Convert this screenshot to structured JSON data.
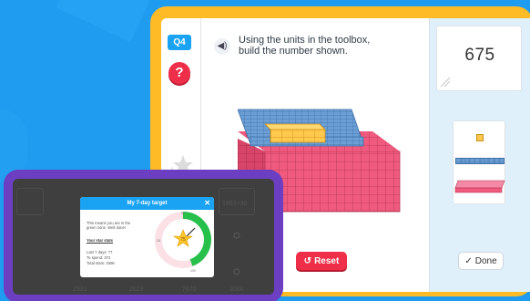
{
  "question": {
    "badge": "Q4",
    "help_glyph": "?",
    "sound_glyph": "◀)",
    "instruction_line1": "Using the units in the toolbox,",
    "instruction_line2": "build the number shown."
  },
  "target": {
    "number": "675"
  },
  "buttons": {
    "reset_label": "Reset",
    "reset_glyph": "↺",
    "done_label": "Done",
    "done_glyph": "✓"
  },
  "popup": {
    "title": "My 7-day target",
    "close_glyph": "✕",
    "message_line1": "This means you are in the",
    "message_line2": "green zone. Well done!",
    "stats_heading": "Your star stats",
    "last7_label": "Last 7 days:",
    "last7_value": "77",
    "tospend_label": "To spend:",
    "tospend_value": "372",
    "total_label": "Total stars:",
    "total_value": "2596",
    "gauge_value": "75",
    "gauge_top": "50",
    "gauge_left": "25",
    "gauge_bottom": "100"
  },
  "background_tiles": {
    "top_right": "1863+30",
    "bottom": [
      "2931",
      "2023",
      "7670",
      "3006"
    ]
  },
  "colors": {
    "background": "#1f9cf0",
    "tablet_frame": "#ffbb26",
    "purple_frame": "#6c3fc2",
    "hundreds": "#f05a7e",
    "tens": "#6b9fd6",
    "ones": "#ffc94d",
    "accent_blue": "#1aa3f2",
    "reset_red": "#ef2f49",
    "gauge_green": "#26c04b"
  }
}
